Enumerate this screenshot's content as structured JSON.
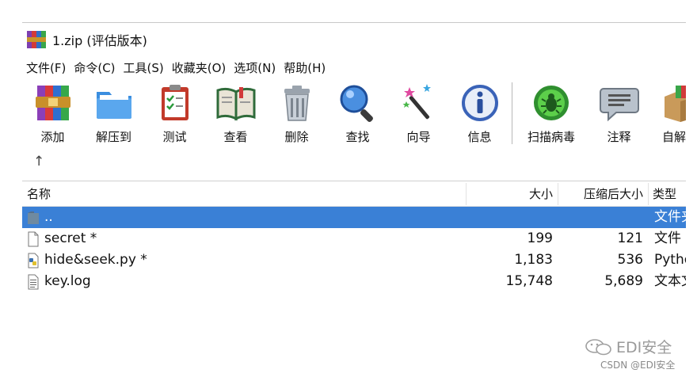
{
  "window": {
    "title": "1.zip (评估版本)"
  },
  "menu": [
    {
      "label": "文件(F)"
    },
    {
      "label": "命令(C)"
    },
    {
      "label": "工具(S)"
    },
    {
      "label": "收藏夹(O)"
    },
    {
      "label": "选项(N)"
    },
    {
      "label": "帮助(H)"
    }
  ],
  "toolbar": {
    "add_label": "添加",
    "extract_label": "解压到",
    "test_label": "测试",
    "view_label": "查看",
    "delete_label": "删除",
    "find_label": "查找",
    "wizard_label": "向导",
    "info_label": "信息",
    "scan_label": "扫描病毒",
    "comment_label": "注释",
    "sfx_label": "自解压"
  },
  "nav": {
    "up_glyph": "↑"
  },
  "columns": {
    "name": "名称",
    "size": "大小",
    "packed": "压缩后大小",
    "type": "类型"
  },
  "files": [
    {
      "name": "..",
      "size": "",
      "packed": "",
      "type": "文件夹",
      "selected": true,
      "icon": "folder-icon"
    },
    {
      "name": "secret *",
      "size": "199",
      "packed": "121",
      "type": "文件",
      "selected": false,
      "icon": "blank-file-icon"
    },
    {
      "name": "hide&seek.py *",
      "size": "1,183",
      "packed": "536",
      "type": "Python",
      "selected": false,
      "icon": "python-file-icon"
    },
    {
      "name": "key.log",
      "size": "15,748",
      "packed": "5,689",
      "type": "文本文档",
      "selected": false,
      "icon": "text-file-icon"
    }
  ],
  "watermark": {
    "text": "EDI安全",
    "credit": "CSDN @EDI安全"
  },
  "colors": {
    "selection": "#3a80d6"
  }
}
